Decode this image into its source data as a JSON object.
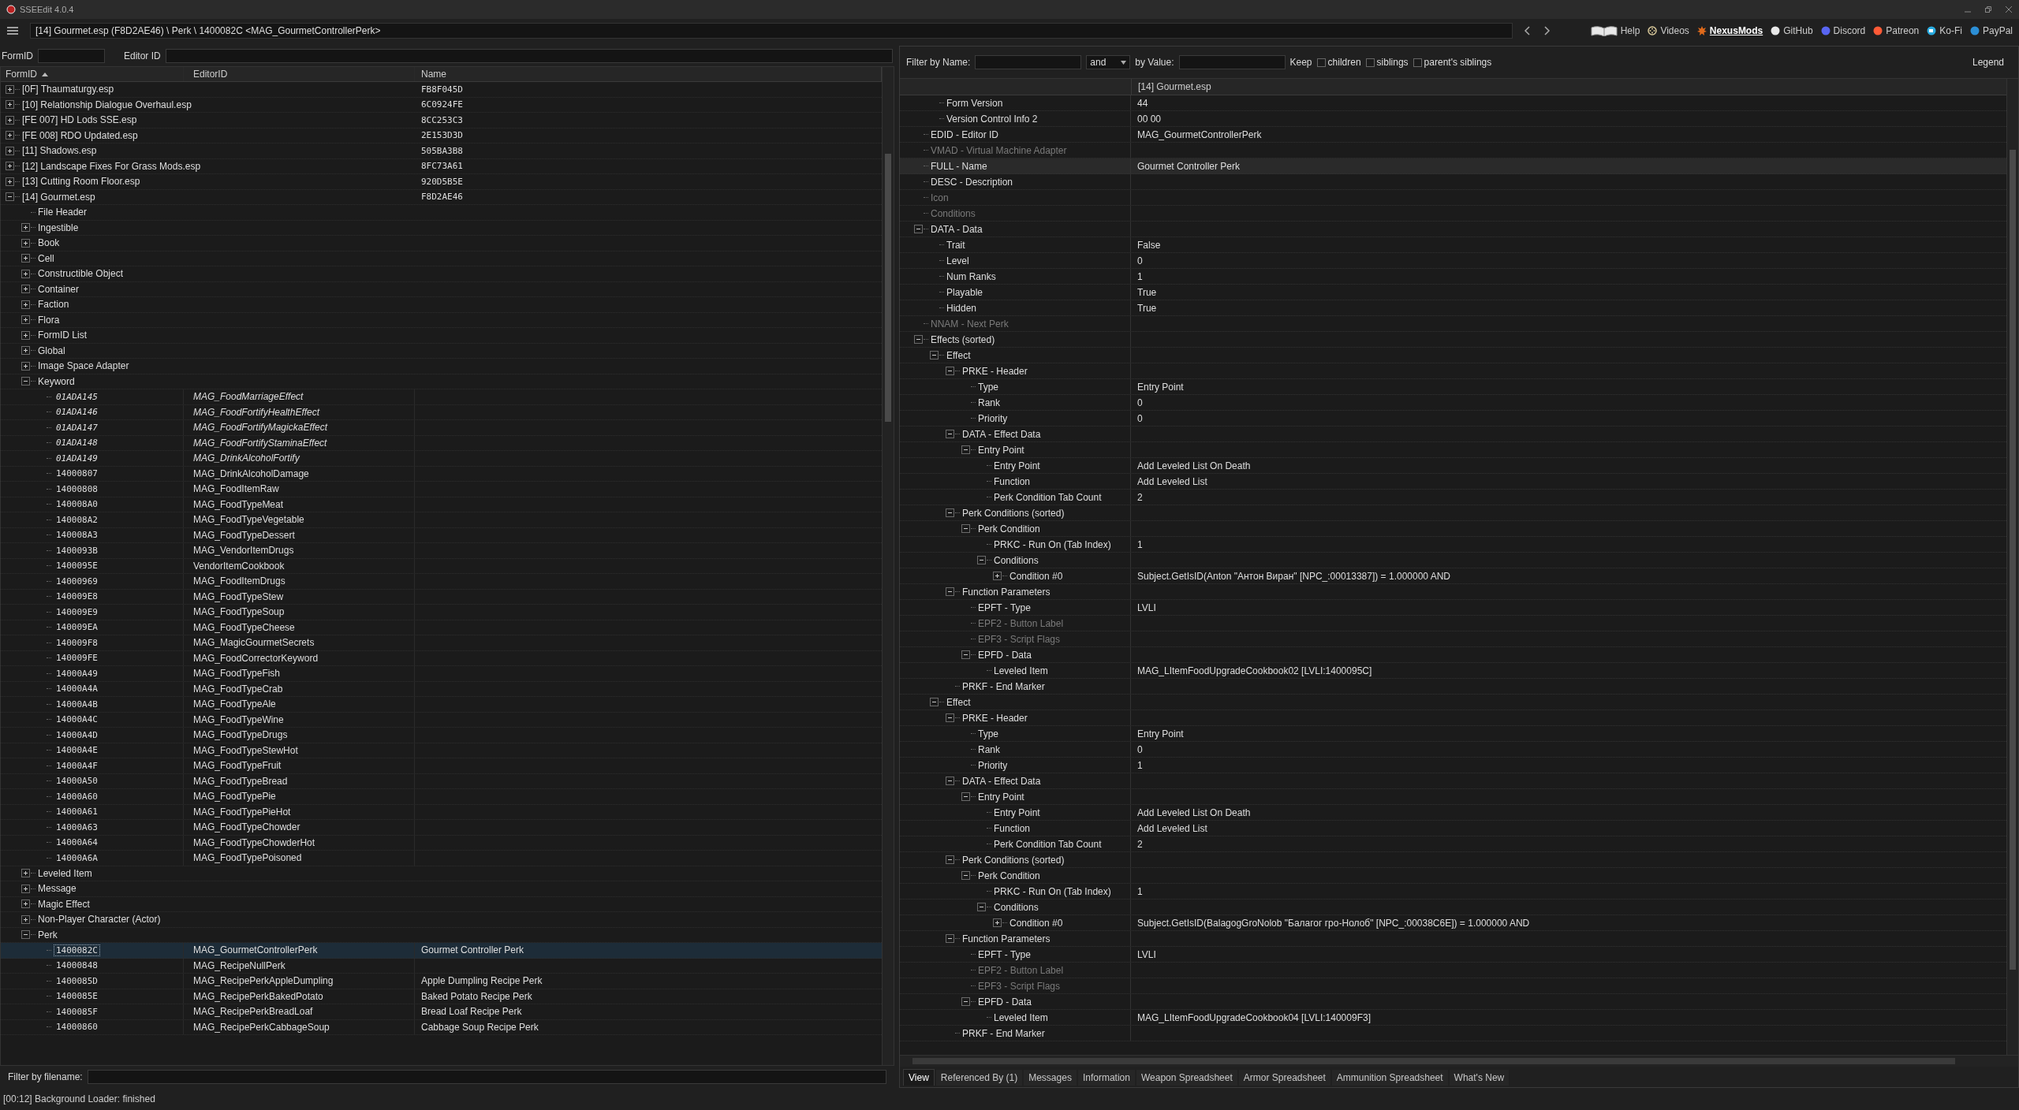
{
  "window": {
    "title": "SSEEdit 4.0.4"
  },
  "toolbar": {
    "path": "[14] Gourmet.esp (F8D2AE46) \\ Perk \\ 1400082C <MAG_GourmetControllerPerk>",
    "links": [
      {
        "label": "Help",
        "highlighted": false
      },
      {
        "label": "Videos",
        "highlighted": false
      },
      {
        "label": "NexusMods",
        "highlighted": true
      },
      {
        "label": "GitHub",
        "highlighted": false
      },
      {
        "label": "Discord",
        "highlighted": false
      },
      {
        "label": "Patreon",
        "highlighted": false
      },
      {
        "label": "Ko-Fi",
        "highlighted": false
      },
      {
        "label": "PayPal",
        "highlighted": false
      }
    ]
  },
  "left_filter": {
    "form_id_label": "FormID",
    "editor_id_label": "Editor ID"
  },
  "left_columns": [
    {
      "label": "FormID",
      "sorted": true
    },
    {
      "label": "EditorID",
      "sorted": false
    },
    {
      "label": "Name",
      "sorted": false
    }
  ],
  "left_tree": [
    {
      "kind": "file",
      "label": "[0F] Thaumaturgy.esp",
      "name": "FB8F045D",
      "expanded": false,
      "selected": false
    },
    {
      "kind": "file",
      "label": "[10] Relationship Dialogue Overhaul.esp",
      "name": "6C0924FE",
      "expanded": false,
      "selected": false
    },
    {
      "kind": "file",
      "label": "[FE 007] HD Lods SSE.esp",
      "name": "8CC253C3",
      "expanded": false,
      "selected": false
    },
    {
      "kind": "file",
      "label": "[FE 008] RDO Updated.esp",
      "name": "2E153D3D",
      "expanded": false,
      "selected": false
    },
    {
      "kind": "file",
      "label": "[11] Shadows.esp",
      "name": "505BA3B8",
      "expanded": false,
      "selected": false
    },
    {
      "kind": "file",
      "label": "[12] Landscape Fixes For Grass Mods.esp",
      "name": "8FC73A61",
      "expanded": false,
      "selected": false
    },
    {
      "kind": "file",
      "label": "[13] Cutting Room Floor.esp",
      "name": "920D5B5E",
      "expanded": false,
      "selected": false
    },
    {
      "kind": "file",
      "label": "[14] Gourmet.esp",
      "name": "F8D2AE46",
      "expanded": true,
      "selected": false,
      "children": [
        {
          "kind": "group",
          "label": "File Header",
          "selected": false
        },
        {
          "kind": "group",
          "label": "Ingestible",
          "expanded": false,
          "selected": false
        },
        {
          "kind": "group",
          "label": "Book",
          "expanded": false,
          "selected": false
        },
        {
          "kind": "group",
          "label": "Cell",
          "expanded": false,
          "selected": false
        },
        {
          "kind": "group",
          "label": "Constructible Object",
          "expanded": false,
          "selected": false
        },
        {
          "kind": "group",
          "label": "Container",
          "expanded": false,
          "selected": false
        },
        {
          "kind": "group",
          "label": "Faction",
          "expanded": false,
          "selected": false
        },
        {
          "kind": "group",
          "label": "Flora",
          "expanded": false,
          "selected": false
        },
        {
          "kind": "group",
          "label": "FormID List",
          "expanded": false,
          "selected": false
        },
        {
          "kind": "group",
          "label": "Global",
          "expanded": false,
          "selected": false
        },
        {
          "kind": "group",
          "label": "Image Space Adapter",
          "expanded": false,
          "selected": false
        },
        {
          "kind": "group",
          "label": "Keyword",
          "expanded": true,
          "selected": false,
          "children": [
            {
              "kind": "record",
              "form_id": "01ADA145",
              "editor_id": "MAG_FoodMarriageEffect",
              "from_master": true,
              "selected": false
            },
            {
              "kind": "record",
              "form_id": "01ADA146",
              "editor_id": "MAG_FoodFortifyHealthEffect",
              "from_master": true,
              "selected": false
            },
            {
              "kind": "record",
              "form_id": "01ADA147",
              "editor_id": "MAG_FoodFortifyMagickaEffect",
              "from_master": true,
              "selected": false
            },
            {
              "kind": "record",
              "form_id": "01ADA148",
              "editor_id": "MAG_FoodFortifyStaminaEffect",
              "from_master": true,
              "selected": false
            },
            {
              "kind": "record",
              "form_id": "01ADA149",
              "editor_id": "MAG_DrinkAlcoholFortify",
              "from_master": true,
              "selected": false
            },
            {
              "kind": "record",
              "form_id": "14000807",
              "editor_id": "MAG_DrinkAlcoholDamage",
              "from_master": false,
              "selected": false
            },
            {
              "kind": "record",
              "form_id": "14000808",
              "editor_id": "MAG_FoodItemRaw",
              "from_master": false,
              "selected": false
            },
            {
              "kind": "record",
              "form_id": "140008A0",
              "editor_id": "MAG_FoodTypeMeat",
              "from_master": false,
              "selected": false
            },
            {
              "kind": "record",
              "form_id": "140008A2",
              "editor_id": "MAG_FoodTypeVegetable",
              "from_master": false,
              "selected": false
            },
            {
              "kind": "record",
              "form_id": "140008A3",
              "editor_id": "MAG_FoodTypeDessert",
              "from_master": false,
              "selected": false
            },
            {
              "kind": "record",
              "form_id": "1400093B",
              "editor_id": "MAG_VendorItemDrugs",
              "from_master": false,
              "selected": false
            },
            {
              "kind": "record",
              "form_id": "1400095E",
              "editor_id": "VendorItemCookbook",
              "from_master": false,
              "selected": false
            },
            {
              "kind": "record",
              "form_id": "14000969",
              "editor_id": "MAG_FoodItemDrugs",
              "from_master": false,
              "selected": false
            },
            {
              "kind": "record",
              "form_id": "140009E8",
              "editor_id": "MAG_FoodTypeStew",
              "from_master": false,
              "selected": false
            },
            {
              "kind": "record",
              "form_id": "140009E9",
              "editor_id": "MAG_FoodTypeSoup",
              "from_master": false,
              "selected": false
            },
            {
              "kind": "record",
              "form_id": "140009EA",
              "editor_id": "MAG_FoodTypeCheese",
              "from_master": false,
              "selected": false
            },
            {
              "kind": "record",
              "form_id": "140009F8",
              "editor_id": "MAG_MagicGourmetSecrets",
              "from_master": false,
              "selected": false
            },
            {
              "kind": "record",
              "form_id": "140009FE",
              "editor_id": "MAG_FoodCorrectorKeyword",
              "from_master": false,
              "selected": false
            },
            {
              "kind": "record",
              "form_id": "14000A49",
              "editor_id": "MAG_FoodTypeFish",
              "from_master": false,
              "selected": false
            },
            {
              "kind": "record",
              "form_id": "14000A4A",
              "editor_id": "MAG_FoodTypeCrab",
              "from_master": false,
              "selected": false
            },
            {
              "kind": "record",
              "form_id": "14000A4B",
              "editor_id": "MAG_FoodTypeAle",
              "from_master": false,
              "selected": false
            },
            {
              "kind": "record",
              "form_id": "14000A4C",
              "editor_id": "MAG_FoodTypeWine",
              "from_master": false,
              "selected": false
            },
            {
              "kind": "record",
              "form_id": "14000A4D",
              "editor_id": "MAG_FoodTypeDrugs",
              "from_master": false,
              "selected": false
            },
            {
              "kind": "record",
              "form_id": "14000A4E",
              "editor_id": "MAG_FoodTypeStewHot",
              "from_master": false,
              "selected": false
            },
            {
              "kind": "record",
              "form_id": "14000A4F",
              "editor_id": "MAG_FoodTypeFruit",
              "from_master": false,
              "selected": false
            },
            {
              "kind": "record",
              "form_id": "14000A50",
              "editor_id": "MAG_FoodTypeBread",
              "from_master": false,
              "selected": false
            },
            {
              "kind": "record",
              "form_id": "14000A60",
              "editor_id": "MAG_FoodTypePie",
              "from_master": false,
              "selected": false
            },
            {
              "kind": "record",
              "form_id": "14000A61",
              "editor_id": "MAG_FoodTypePieHot",
              "from_master": false,
              "selected": false
            },
            {
              "kind": "record",
              "form_id": "14000A63",
              "editor_id": "MAG_FoodTypeChowder",
              "from_master": false,
              "selected": false
            },
            {
              "kind": "record",
              "form_id": "14000A64",
              "editor_id": "MAG_FoodTypeChowderHot",
              "from_master": false,
              "selected": false
            },
            {
              "kind": "record",
              "form_id": "14000A6A",
              "editor_id": "MAG_FoodTypePoisoned",
              "from_master": false,
              "selected": false
            }
          ]
        },
        {
          "kind": "group",
          "label": "Leveled Item",
          "expanded": false,
          "selected": false
        },
        {
          "kind": "group",
          "label": "Message",
          "expanded": false,
          "selected": false
        },
        {
          "kind": "group",
          "label": "Magic Effect",
          "expanded": false,
          "selected": false
        },
        {
          "kind": "group",
          "label": "Non-Player Character (Actor)",
          "expanded": false,
          "selected": false
        },
        {
          "kind": "group",
          "label": "Perk",
          "expanded": true,
          "selected": false,
          "children": [
            {
              "kind": "record",
              "form_id": "1400082C",
              "editor_id": "MAG_GourmetControllerPerk",
              "name": "Gourmet Controller Perk",
              "from_master": false,
              "selected": true
            },
            {
              "kind": "record",
              "form_id": "14000848",
              "editor_id": "MAG_RecipeNullPerk",
              "from_master": false,
              "selected": false
            },
            {
              "kind": "record",
              "form_id": "1400085D",
              "editor_id": "MAG_RecipePerkAppleDumpling",
              "name": "Apple Dumpling Recipe Perk",
              "from_master": false,
              "selected": false
            },
            {
              "kind": "record",
              "form_id": "1400085E",
              "editor_id": "MAG_RecipePerkBakedPotato",
              "name": "Baked Potato Recipe Perk",
              "from_master": false,
              "selected": false
            },
            {
              "kind": "record",
              "form_id": "1400085F",
              "editor_id": "MAG_RecipePerkBreadLoaf",
              "name": "Bread Loaf Recipe Perk",
              "from_master": false,
              "selected": false
            },
            {
              "kind": "record",
              "form_id": "14000860",
              "editor_id": "MAG_RecipePerkCabbageSoup",
              "name": "Cabbage Soup Recipe Perk",
              "from_master": false,
              "selected": false
            }
          ]
        }
      ]
    }
  ],
  "file_filter": {
    "label": "Filter by filename:"
  },
  "status_bar": "[00:12] Background Loader: finished",
  "right_filter": {
    "name_label": "Filter by Name:",
    "operator": "and",
    "value_label": "by Value:",
    "keep_label": "Keep",
    "keep_options": [
      {
        "label": "children",
        "checked": false
      },
      {
        "label": "siblings",
        "checked": false
      },
      {
        "label": "parent's siblings",
        "checked": false
      }
    ],
    "legend": "Legend"
  },
  "record_header": "[14] Gourmet.esp",
  "continued_fields": [
    {
      "label": "Form Version",
      "value": "44",
      "disabled": false,
      "selected": false
    },
    {
      "label": "Version Control Info 2",
      "value": "00 00",
      "disabled": false,
      "selected": false
    }
  ],
  "record_fields": [
    {
      "label": "EDID - Editor ID",
      "value": "MAG_GourmetControllerPerk",
      "disabled": false,
      "selected": false
    },
    {
      "label": "VMAD - Virtual Machine Adapter",
      "disabled": true,
      "selected": false
    },
    {
      "label": "FULL - Name",
      "value": "Gourmet Controller Perk",
      "disabled": false,
      "selected": true
    },
    {
      "label": "DESC - Description",
      "disabled": false,
      "selected": false
    },
    {
      "label": "Icon",
      "disabled": true,
      "selected": false
    },
    {
      "label": "Conditions",
      "disabled": true,
      "selected": false
    },
    {
      "label": "DATA - Data",
      "expanded": true,
      "disabled": false,
      "selected": false,
      "children": [
        {
          "label": "Trait",
          "value": "False",
          "disabled": false,
          "selected": false
        },
        {
          "label": "Level",
          "value": "0",
          "disabled": false,
          "selected": false
        },
        {
          "label": "Num Ranks",
          "value": "1",
          "disabled": false,
          "selected": false
        },
        {
          "label": "Playable",
          "value": "True",
          "disabled": false,
          "selected": false
        },
        {
          "label": "Hidden",
          "value": "True",
          "disabled": false,
          "selected": false
        }
      ]
    },
    {
      "label": "NNAM - Next Perk",
      "disabled": true,
      "selected": false
    },
    {
      "label": "Effects (sorted)",
      "expanded": true,
      "disabled": false,
      "selected": false,
      "children": [
        {
          "label": "Effect",
          "expanded": true,
          "disabled": false,
          "selected": false,
          "children": [
            {
              "label": "PRKE - Header",
              "expanded": true,
              "disabled": false,
              "selected": false,
              "children": [
                {
                  "label": "Type",
                  "value": "Entry Point",
                  "disabled": false,
                  "selected": false
                },
                {
                  "label": "Rank",
                  "value": "0",
                  "disabled": false,
                  "selected": false
                },
                {
                  "label": "Priority",
                  "value": "0",
                  "disabled": false,
                  "selected": false
                }
              ]
            },
            {
              "label": "DATA - Effect Data",
              "expanded": true,
              "disabled": false,
              "selected": false,
              "children": [
                {
                  "label": "Entry Point",
                  "expanded": true,
                  "disabled": false,
                  "selected": false,
                  "children": [
                    {
                      "label": "Entry Point",
                      "value": "Add Leveled List On Death",
                      "disabled": false,
                      "selected": false
                    },
                    {
                      "label": "Function",
                      "value": "Add Leveled List",
                      "disabled": false,
                      "selected": false
                    },
                    {
                      "label": "Perk Condition Tab Count",
                      "value": "2",
                      "disabled": false,
                      "selected": false
                    }
                  ]
                }
              ]
            },
            {
              "label": "Perk Conditions (sorted)",
              "expanded": true,
              "disabled": false,
              "selected": false,
              "children": [
                {
                  "label": "Perk Condition",
                  "expanded": true,
                  "disabled": false,
                  "selected": false,
                  "children": [
                    {
                      "label": "PRKC - Run On (Tab Index)",
                      "value": "1",
                      "disabled": false,
                      "selected": false
                    },
                    {
                      "label": "Conditions",
                      "expanded": true,
                      "disabled": false,
                      "selected": false,
                      "children": [
                        {
                          "label": "Condition #0",
                          "value": "Subject.GetIsID(Anton \"Антон Виран\" [NPC_:00013387]) = 1.000000 AND",
                          "expanded": false,
                          "disabled": false,
                          "selected": false
                        }
                      ]
                    }
                  ]
                }
              ]
            },
            {
              "label": "Function Parameters",
              "expanded": true,
              "disabled": false,
              "selected": false,
              "children": [
                {
                  "label": "EPFT - Type",
                  "value": "LVLI",
                  "disabled": false,
                  "selected": false
                },
                {
                  "label": "EPF2 - Button Label",
                  "disabled": true,
                  "selected": false
                },
                {
                  "label": "EPF3 - Script Flags",
                  "disabled": true,
                  "selected": false
                },
                {
                  "label": "EPFD - Data",
                  "expanded": true,
                  "disabled": false,
                  "selected": false,
                  "children": [
                    {
                      "label": "Leveled Item",
                      "value": "MAG_LItemFoodUpgradeCookbook02 [LVLI:1400095C]",
                      "disabled": false,
                      "selected": false
                    }
                  ]
                }
              ]
            },
            {
              "label": "PRKF - End Marker",
              "disabled": false,
              "selected": false
            }
          ]
        },
        {
          "label": "Effect",
          "expanded": true,
          "disabled": false,
          "selected": false,
          "children": [
            {
              "label": "PRKE - Header",
              "expanded": true,
              "disabled": false,
              "selected": false,
              "children": [
                {
                  "label": "Type",
                  "value": "Entry Point",
                  "disabled": false,
                  "selected": false
                },
                {
                  "label": "Rank",
                  "value": "0",
                  "disabled": false,
                  "selected": false
                },
                {
                  "label": "Priority",
                  "value": "1",
                  "disabled": false,
                  "selected": false
                }
              ]
            },
            {
              "label": "DATA - Effect Data",
              "expanded": true,
              "disabled": false,
              "selected": false,
              "children": [
                {
                  "label": "Entry Point",
                  "expanded": true,
                  "disabled": false,
                  "selected": false,
                  "children": [
                    {
                      "label": "Entry Point",
                      "value": "Add Leveled List On Death",
                      "disabled": false,
                      "selected": false
                    },
                    {
                      "label": "Function",
                      "value": "Add Leveled List",
                      "disabled": false,
                      "selected": false
                    },
                    {
                      "label": "Perk Condition Tab Count",
                      "value": "2",
                      "disabled": false,
                      "selected": false
                    }
                  ]
                }
              ]
            },
            {
              "label": "Perk Conditions (sorted)",
              "expanded": true,
              "disabled": false,
              "selected": false,
              "children": [
                {
                  "label": "Perk Condition",
                  "expanded": true,
                  "disabled": false,
                  "selected": false,
                  "children": [
                    {
                      "label": "PRKC - Run On (Tab Index)",
                      "value": "1",
                      "disabled": false,
                      "selected": false
                    },
                    {
                      "label": "Conditions",
                      "expanded": true,
                      "disabled": false,
                      "selected": false,
                      "children": [
                        {
                          "label": "Condition #0",
                          "value": "Subject.GetIsID(BalagogGroNolob \"Балагог гро-Нолоб\" [NPC_:00038C6E]) = 1.000000 AND",
                          "expanded": false,
                          "disabled": false,
                          "selected": false
                        }
                      ]
                    }
                  ]
                }
              ]
            },
            {
              "label": "Function Parameters",
              "expanded": true,
              "disabled": false,
              "selected": false,
              "children": [
                {
                  "label": "EPFT - Type",
                  "value": "LVLI",
                  "disabled": false,
                  "selected": false
                },
                {
                  "label": "EPF2 - Button Label",
                  "disabled": true,
                  "selected": false
                },
                {
                  "label": "EPF3 - Script Flags",
                  "disabled": true,
                  "selected": false
                },
                {
                  "label": "EPFD - Data",
                  "expanded": true,
                  "disabled": false,
                  "selected": false,
                  "children": [
                    {
                      "label": "Leveled Item",
                      "value": "MAG_LItemFoodUpgradeCookbook04 [LVLI:140009F3]",
                      "disabled": false,
                      "selected": false
                    }
                  ]
                }
              ]
            },
            {
              "label": "PRKF - End Marker",
              "disabled": false,
              "selected": false
            }
          ]
        }
      ]
    }
  ],
  "bottom_tabs": [
    {
      "label": "View",
      "selected": true
    },
    {
      "label": "Referenced By (1)",
      "selected": false
    },
    {
      "label": "Messages",
      "selected": false
    },
    {
      "label": "Information",
      "selected": false
    },
    {
      "label": "Weapon Spreadsheet",
      "selected": false
    },
    {
      "label": "Armor Spreadsheet",
      "selected": false
    },
    {
      "label": "Ammunition Spreadsheet",
      "selected": false
    },
    {
      "label": "What's New",
      "selected": false
    }
  ]
}
